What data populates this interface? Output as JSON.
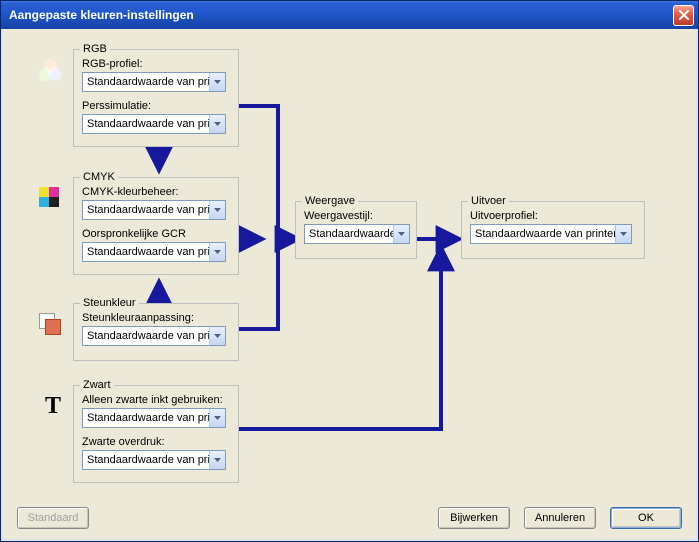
{
  "window": {
    "title": "Aangepaste kleuren-instellingen"
  },
  "flow_color": "#18189c",
  "rgb": {
    "legend": "RGB",
    "profile_label": "RGB-profiel:",
    "profile_value": "Standaardwaarde van pri",
    "press_label": "Perssimulatie:",
    "press_value": "Standaardwaarde van pri"
  },
  "cmyk": {
    "legend": "CMYK",
    "mgmt_label": "CMYK-kleurbeheer:",
    "mgmt_value": "Standaardwaarde van pri",
    "gcr_label": "Oorspronkelijke GCR",
    "gcr_value": "Standaardwaarde van pri"
  },
  "spot": {
    "legend": "Steunkleur",
    "match_label": "Steunkleuraanpassing:",
    "match_value": "Standaardwaarde van pri"
  },
  "black": {
    "legend": "Zwart",
    "only_label": "Alleen zwarte inkt gebruiken:",
    "only_value": "Standaardwaarde van pri",
    "overprint_label": "Zwarte overdruk:",
    "overprint_value": "Standaardwaarde van pri"
  },
  "display": {
    "legend": "Weergave",
    "style_label": "Weergavestijl:",
    "style_value": "Standaardwaarde"
  },
  "output": {
    "legend": "Uitvoer",
    "profile_label": "Uitvoerprofiel:",
    "profile_value": "Standaardwaarde van printer"
  },
  "buttons": {
    "default": "Standaard",
    "update": "Bijwerken",
    "cancel": "Annuleren",
    "ok": "OK"
  }
}
